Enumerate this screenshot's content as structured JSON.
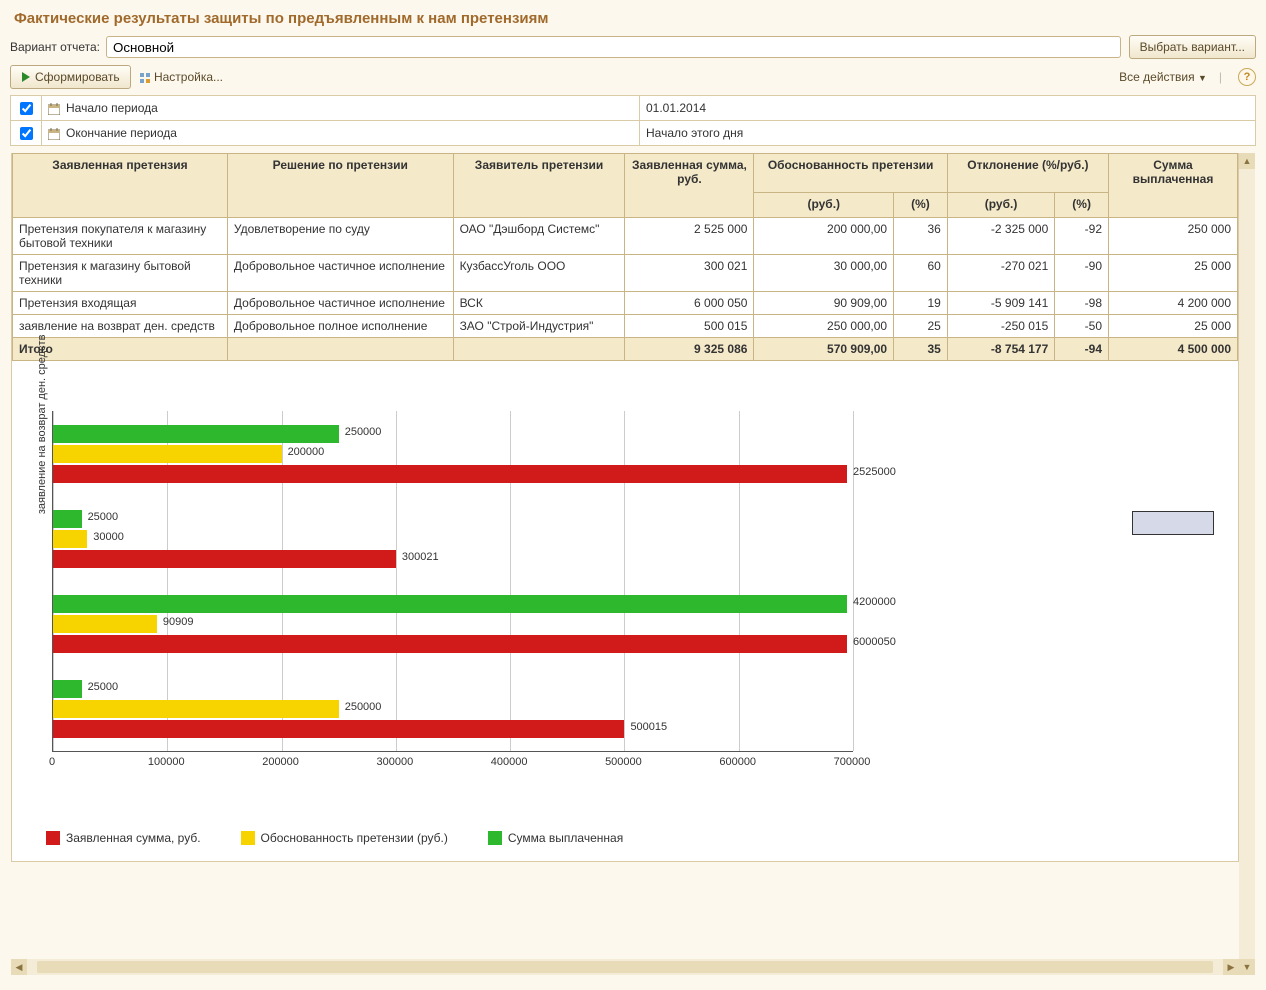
{
  "title": "Фактические результаты защиты по предъявленным  к нам претензиям",
  "variant": {
    "label": "Вариант отчета:",
    "value": "Основной",
    "choose_button": "Выбрать вариант..."
  },
  "toolbar": {
    "generate": "Сформировать",
    "settings": "Настройка...",
    "all_actions": "Все действия"
  },
  "params": [
    {
      "checked": true,
      "label": "Начало периода",
      "value": "01.01.2014"
    },
    {
      "checked": true,
      "label": "Окончание периода",
      "value": "Начало этого дня"
    }
  ],
  "table": {
    "headers": {
      "claim": "Заявленная претензия",
      "decision": "Решение по претензии",
      "applicant": "Заявитель претензии",
      "amount": "Заявленная сумма, руб.",
      "validity": "Обоснованность претензии",
      "deviation": "Отклонение (%/руб.)",
      "paid": "Сумма выплаченная",
      "rub": "(руб.)",
      "pct": "(%)"
    },
    "rows": [
      {
        "claim": "Претензия покупателя к магазину бытовой техники",
        "decision": "Удовлетворение по суду",
        "applicant": "ОАО \"Дэшборд Системс\"",
        "amount": "2 525 000",
        "vrub": "200 000,00",
        "vpct": "36",
        "drub": "-2 325 000",
        "dpct": "-92",
        "paid": "250 000"
      },
      {
        "claim": "Претензия к магазину бытовой техники",
        "decision": "Добровольное частичное исполнение",
        "applicant": "КузбассУголь ООО",
        "amount": "300 021",
        "vrub": "30 000,00",
        "vpct": "60",
        "drub": "-270 021",
        "dpct": "-90",
        "paid": "25 000"
      },
      {
        "claim": "Претензия входящая",
        "decision": "Добровольное частичное исполнение",
        "applicant": "ВСК",
        "amount": "6 000 050",
        "vrub": "90 909,00",
        "vpct": "19",
        "drub": "-5 909 141",
        "dpct": "-98",
        "paid": "4 200 000"
      },
      {
        "claim": "заявление на возврат ден. средств",
        "decision": "Добровольное полное исполнение",
        "applicant": "ЗАО \"Строй-Индустрия\"",
        "amount": "500 015",
        "vrub": "250 000,00",
        "vpct": "25",
        "drub": "-250 015",
        "dpct": "-50",
        "paid": "25 000"
      }
    ],
    "total": {
      "label": "Итого",
      "amount": "9 325 086",
      "vrub": "570 909,00",
      "vpct": "35",
      "drub": "-8 754 177",
      "dpct": "-94",
      "paid": "4 500 000"
    }
  },
  "chart_data": {
    "type": "bar",
    "orientation": "horizontal",
    "xlabel": "",
    "ylabel": "заявление на возврат ден. средств",
    "xlim": [
      0,
      700000
    ],
    "xticks": [
      0,
      100000,
      200000,
      300000,
      400000,
      500000,
      600000,
      700000
    ],
    "categories": [
      "Претензия покупателя к магазину бытовой техники",
      "Претензия к магазину бытовой техники",
      "Претензия входящая",
      "заявление на возврат ден. средств"
    ],
    "series": [
      {
        "name": "Сумма выплаченная",
        "color": "#2eb82e",
        "values": [
          250000,
          25000,
          4200000,
          25000
        ]
      },
      {
        "name": "Обоснованность претензии (руб.)",
        "color": "#f7d400",
        "values": [
          200000,
          30000,
          90909,
          250000
        ]
      },
      {
        "name": "Заявленная сумма, руб.",
        "color": "#d11a1a",
        "values": [
          2525000,
          300021,
          6000050,
          500015
        ]
      }
    ],
    "legend": [
      "Заявленная сумма, руб.",
      "Обоснованность претензии (руб.)",
      "Сумма выплаченная"
    ]
  }
}
